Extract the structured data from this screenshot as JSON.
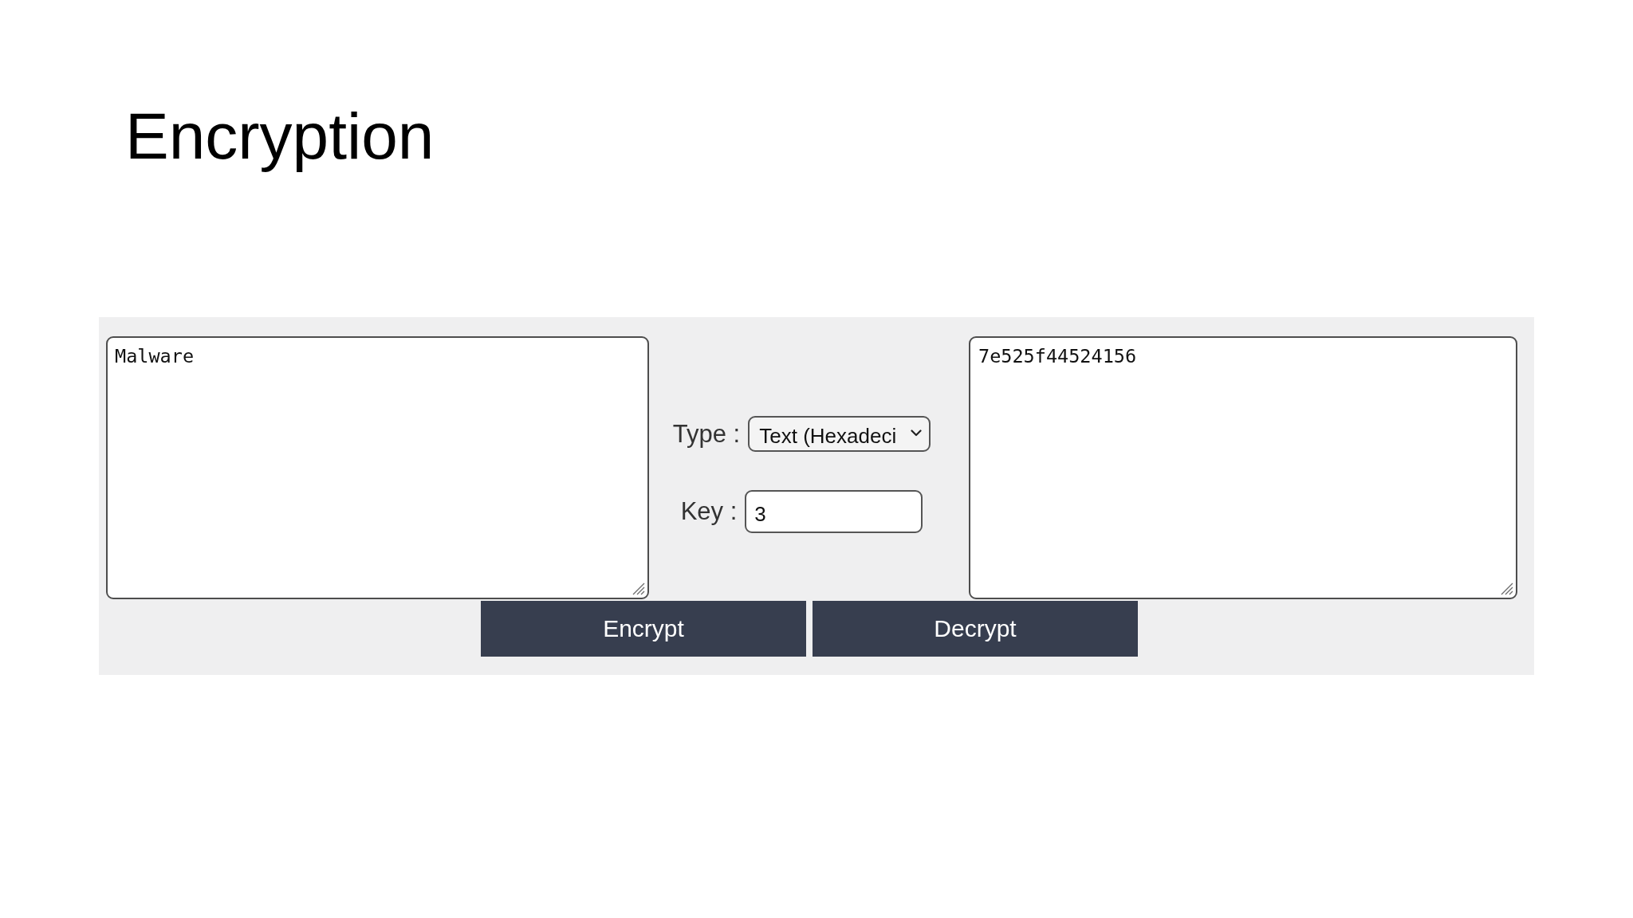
{
  "title": "Encryption",
  "input_text": {
    "value": "Malware"
  },
  "type_select": {
    "label": "Type :",
    "value": "Text (Hexadeci"
  },
  "key_field": {
    "label": "Key :",
    "value": "3"
  },
  "output_text": {
    "value": "7e525f44524156"
  },
  "buttons": [
    "Encrypt",
    "Decrypt"
  ]
}
